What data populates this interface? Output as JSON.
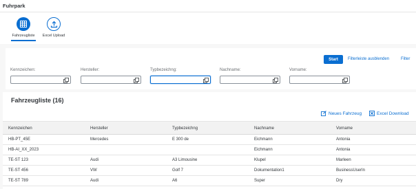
{
  "app": {
    "title": "Fuhrpark"
  },
  "tabs": [
    {
      "label": "Fahrzeugliste",
      "icon": "grid-table-icon",
      "active": true
    },
    {
      "label": "Excel Upload",
      "icon": "upload-icon",
      "active": false
    }
  ],
  "filterbar": {
    "start_label": "Start",
    "hide_label": "Filterleiste ausblenden",
    "filter_label": "Filter",
    "fields": [
      {
        "label": "Kennzeichen:",
        "value": "",
        "placeholder": ""
      },
      {
        "label": "Hersteller:",
        "value": "",
        "placeholder": ""
      },
      {
        "label": "Typbezeichng:",
        "value": "",
        "placeholder": ""
      },
      {
        "label": "Nachname:",
        "value": "",
        "placeholder": ""
      },
      {
        "label": "Vorname:",
        "value": "",
        "placeholder": ""
      }
    ]
  },
  "table": {
    "title": "Fahrzeugliste (16)",
    "new_label": "Neues Fahrzeug",
    "download_label": "Excel Download",
    "columns": [
      "Kennzeichen",
      "Hersteller",
      "Typbezeichng",
      "Nachname",
      "Vorname"
    ],
    "rows": [
      [
        "HB-PT_45E",
        "Mercedes",
        "E 300 de",
        "Eichmann",
        "Antonia"
      ],
      [
        "HB-AI_XX_2023",
        "",
        "",
        "Eichmann",
        "Antonia"
      ],
      [
        "TE-ST 123",
        "Audi",
        "A3 Limousine",
        "Klupel",
        "Marleen"
      ],
      [
        "TE-ST 456",
        "VW",
        "Golf 7",
        "Dokumentation1",
        "BusinessUserIn"
      ],
      [
        "TE-ST 789",
        "Audi",
        "A6",
        "Super",
        "Dry"
      ]
    ]
  },
  "colors": {
    "accent": "#0a6ed1",
    "background": "#f7f7f7",
    "text": "#32363a"
  }
}
